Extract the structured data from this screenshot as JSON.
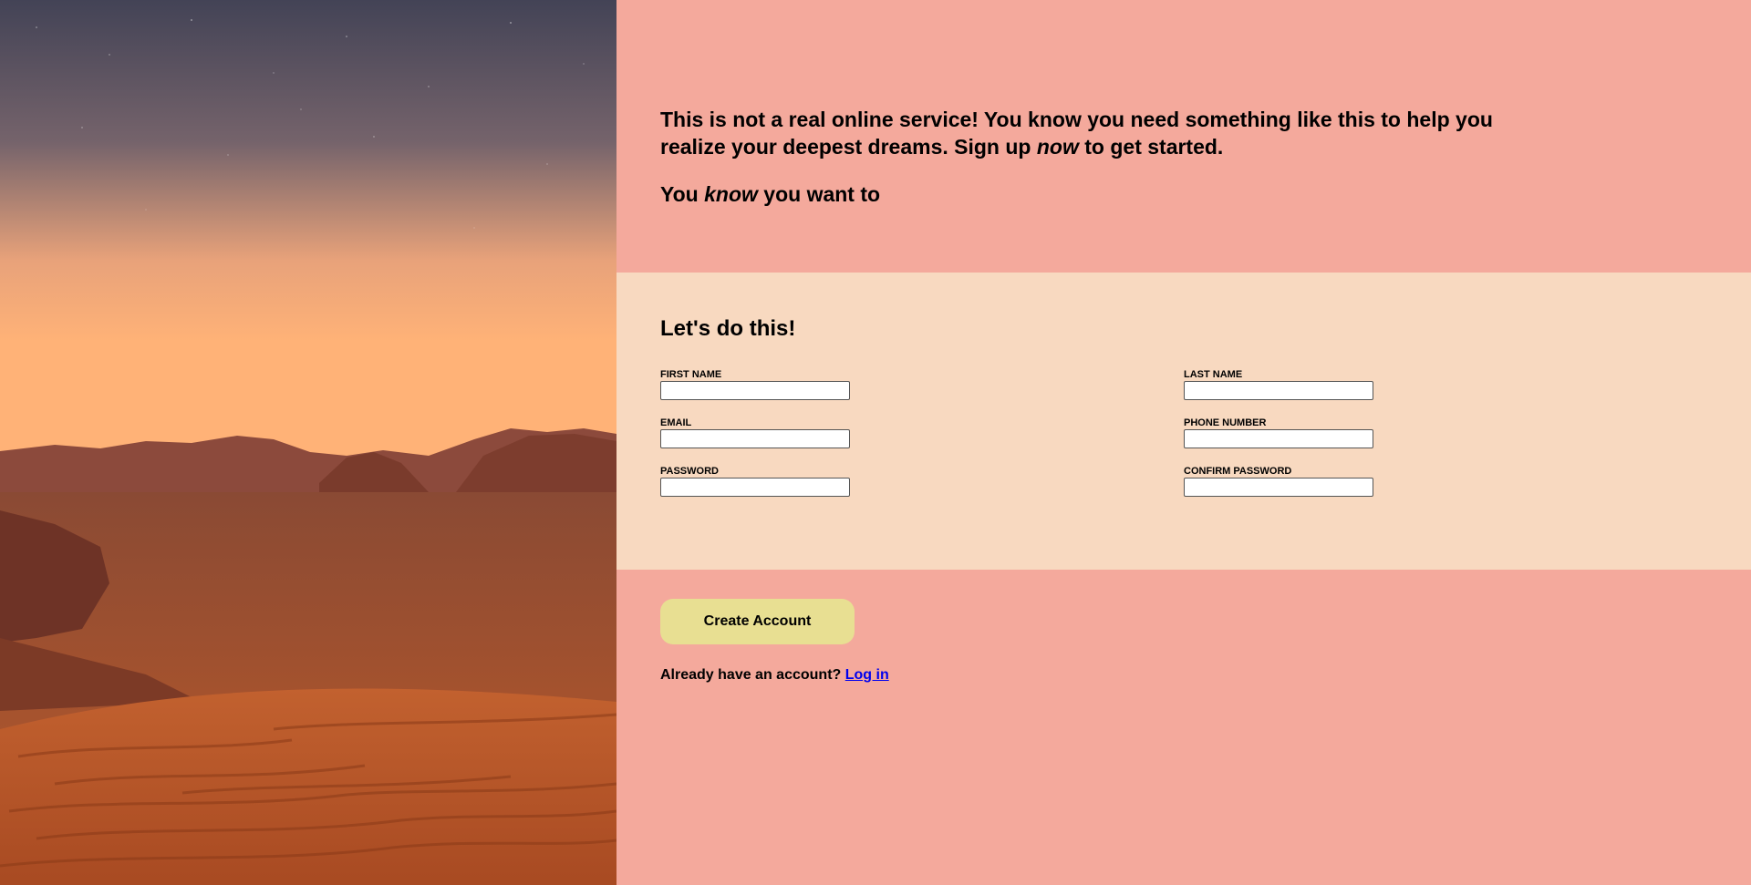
{
  "intro": {
    "line1_before": "This is not a real online service! You know you need something like this to help you realize your deepest dreams. Sign up ",
    "line1_em": "now",
    "line1_after": " to get started.",
    "line2_before": "You ",
    "line2_em": "know",
    "line2_after": " you want to"
  },
  "form": {
    "heading": "Let's do this!",
    "fields": {
      "first_name": {
        "label": "First Name",
        "value": "",
        "placeholder": ""
      },
      "last_name": {
        "label": "Last Name",
        "value": "",
        "placeholder": ""
      },
      "email": {
        "label": "Email",
        "value": "",
        "placeholder": ""
      },
      "phone": {
        "label": "Phone Number",
        "value": "",
        "placeholder": ""
      },
      "password": {
        "label": "Password",
        "value": "",
        "placeholder": ""
      },
      "confirm_password": {
        "label": "Confirm Password",
        "value": "",
        "placeholder": ""
      }
    }
  },
  "actions": {
    "create_label": "Create Account",
    "login_prompt": "Already have an account? ",
    "login_link": "Log in"
  },
  "colors": {
    "accent_pink": "#f4a99c",
    "form_background": "#f8d9c0",
    "button_yellow": "#e8df92",
    "link_blue": "#0000ee"
  }
}
